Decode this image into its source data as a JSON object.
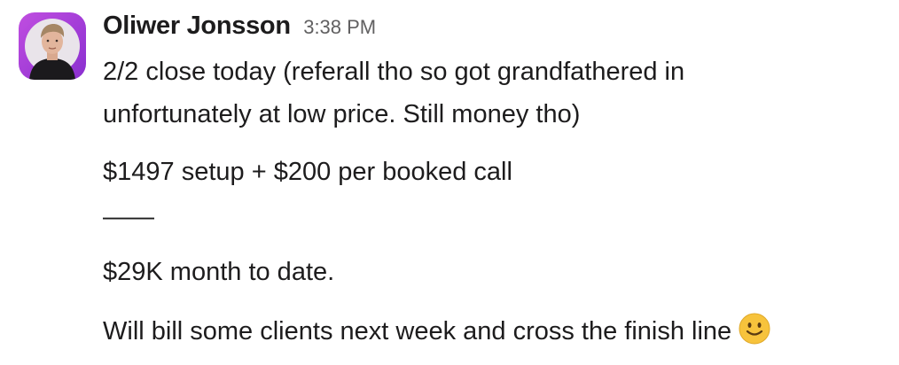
{
  "message": {
    "sender": "Oliwer Jonsson",
    "timestamp": "3:38 PM",
    "lines": [
      "2/2 close today (referall tho so got grandfathered in",
      "unfortunately at low price. Still money tho)",
      "$1497 setup + $200 per booked call",
      "——",
      "$29K month to date.",
      "Will bill some clients next week and cross the finish line"
    ],
    "emoji": "slightly-smiling-face-icon",
    "avatar": "user-avatar-photo"
  },
  "colors": {
    "text": "#1d1c1d",
    "timestamp": "#616061",
    "avatar_ring": "#a03ad8",
    "emoji_face": "#f7c33c"
  }
}
